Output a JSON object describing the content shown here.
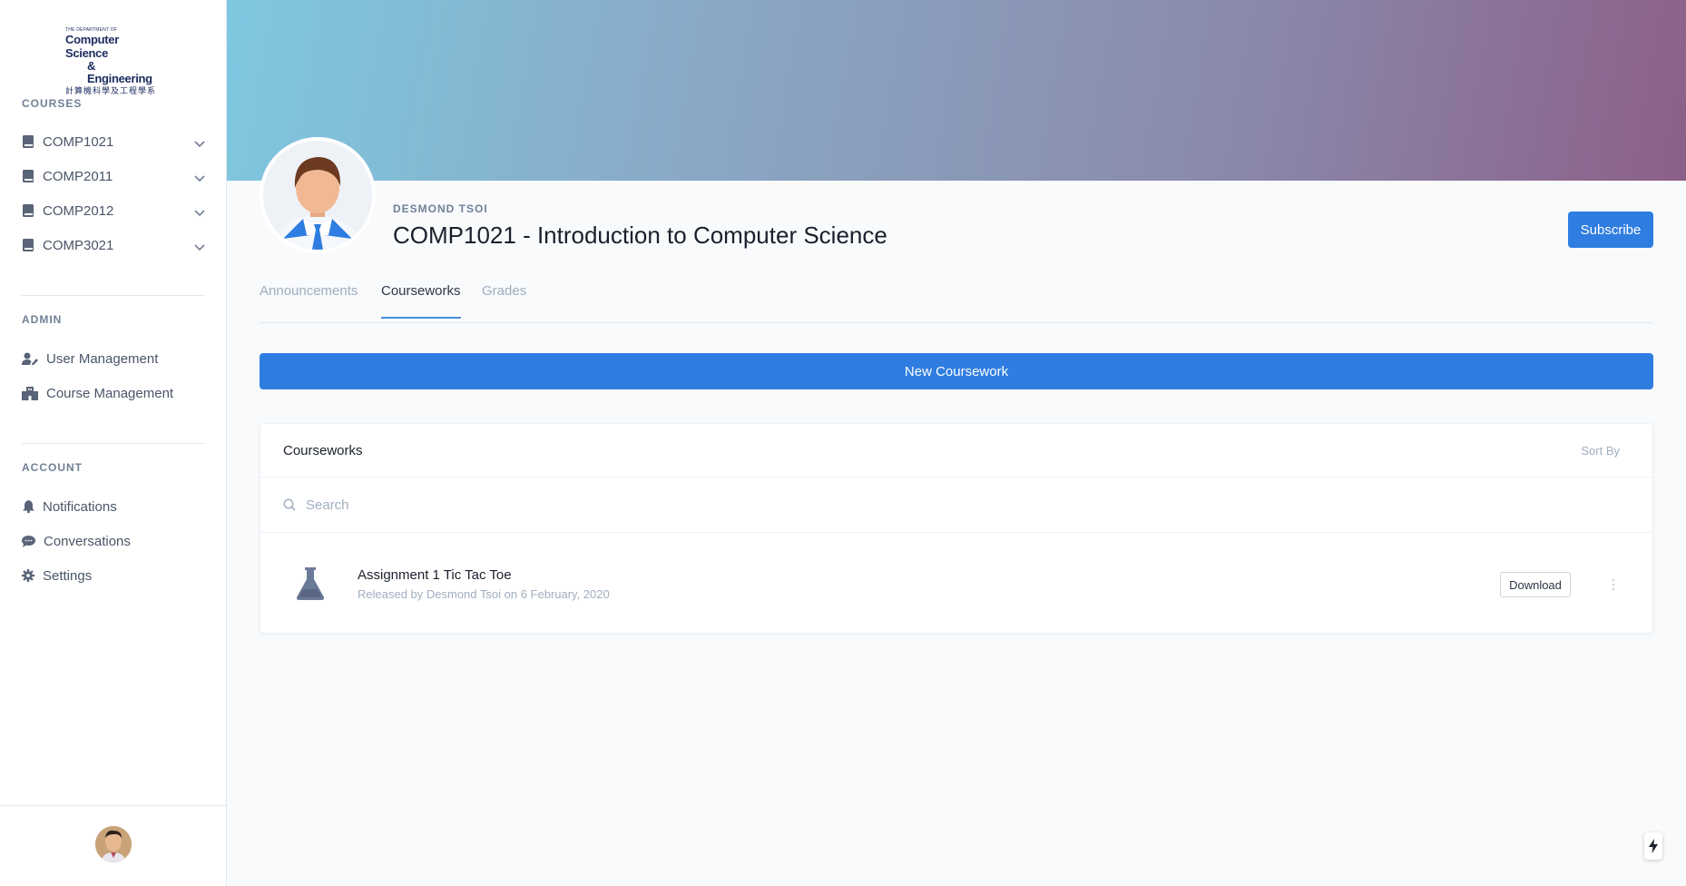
{
  "logo": {
    "line1": "THE DEPARTMENT OF",
    "line2": "Computer Science",
    "line3": "& Engineering",
    "line4": "計算機科學及工程學系"
  },
  "sidebar": {
    "courses_label": "COURSES",
    "courses": [
      {
        "label": "COMP1021",
        "icon": "book-icon"
      },
      {
        "label": "COMP2011",
        "icon": "book-icon"
      },
      {
        "label": "COMP2012",
        "icon": "book-icon"
      },
      {
        "label": "COMP3021",
        "icon": "book-icon"
      }
    ],
    "admin_label": "ADMIN",
    "admin": [
      {
        "label": "User Management",
        "icon": "user-edit-icon"
      },
      {
        "label": "Course Management",
        "icon": "building-icon"
      }
    ],
    "account_label": "ACCOUNT",
    "account": [
      {
        "label": "Notifications",
        "icon": "bell-icon"
      },
      {
        "label": "Conversations",
        "icon": "chat-icon"
      },
      {
        "label": "Settings",
        "icon": "gear-icon"
      }
    ]
  },
  "header": {
    "instructor": "DESMOND TSOI",
    "title": "COMP1021 - Introduction to Computer Science",
    "subscribe_label": "Subscribe"
  },
  "tabs": [
    {
      "label": "Announcements",
      "active": false
    },
    {
      "label": "Courseworks",
      "active": true
    },
    {
      "label": "Grades",
      "active": false
    }
  ],
  "new_coursework_label": "New Coursework",
  "courseworks": {
    "title": "Courseworks",
    "sort_label": "Sort By",
    "search_placeholder": "Search",
    "items": [
      {
        "name": "Assignment 1 Tic Tac Toe",
        "meta": "Released by Desmond Tsoi on 6 February, 2020",
        "download_label": "Download",
        "icon": "flask-icon"
      }
    ]
  },
  "colors": {
    "primary": "#2f7de1",
    "banner_start": "#7ec8e0",
    "banner_end": "#8c6088"
  }
}
